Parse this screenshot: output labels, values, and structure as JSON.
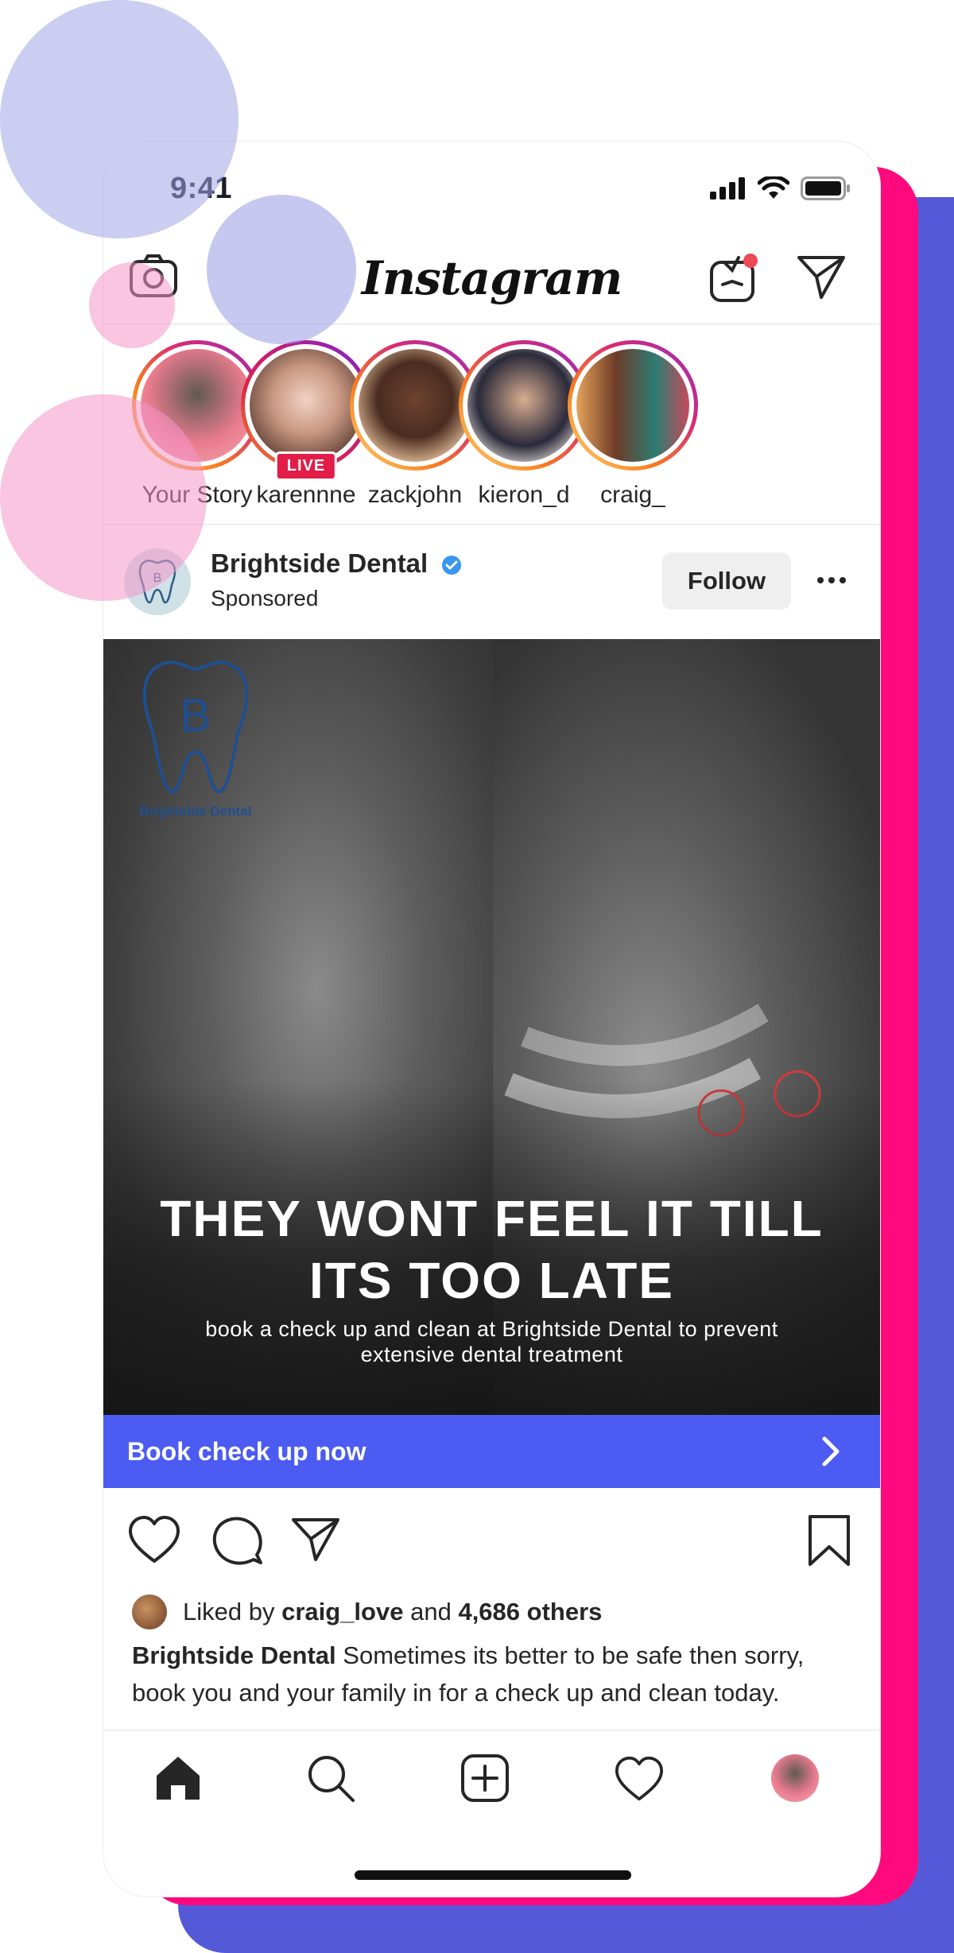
{
  "status_bar": {
    "time": "9:41"
  },
  "header": {
    "brand": "Instagram"
  },
  "stories": [
    {
      "name": "Your Story",
      "live": false
    },
    {
      "name": "karennne",
      "live": true
    },
    {
      "name": "zackjohn",
      "live": false
    },
    {
      "name": "kieron_d",
      "live": false
    },
    {
      "name": "craig_",
      "live": false
    }
  ],
  "live_label": "LIVE",
  "post": {
    "username": "Brightside Dental",
    "sponsored_label": "Sponsored",
    "follow_label": "Follow",
    "image": {
      "logo_letter": "B",
      "logo_name": "Brightside Dental",
      "headline": "THEY WONT FEEL IT TILL ITS TOO LATE",
      "subline": "book a check up and clean at Brightside Dental to prevent extensive dental treatment"
    },
    "cta_label": "Book check up now",
    "likes": {
      "prefix": "Liked by",
      "user": "craig_love",
      "conjunction": "and",
      "others": "4,686 others"
    },
    "caption_user": "Brightside Dental",
    "caption_text": "Sometimes its better to be safe then sorry, book you and your family in for a check up and clean today."
  },
  "colors": {
    "cta": "#4c5bf2",
    "pink_layer": "#ff0a7e",
    "blue_layer": "#5459d8",
    "live_badge": "#e11d48",
    "verified": "#3897f0"
  },
  "icons": {
    "header": [
      "camera-icon",
      "igtv-icon",
      "direct-message-icon"
    ],
    "actions": [
      "heart-icon",
      "comment-icon",
      "share-icon",
      "bookmark-icon"
    ],
    "tabs": [
      "home-icon",
      "search-icon",
      "add-post-icon",
      "activity-heart-icon",
      "profile-avatar"
    ]
  }
}
